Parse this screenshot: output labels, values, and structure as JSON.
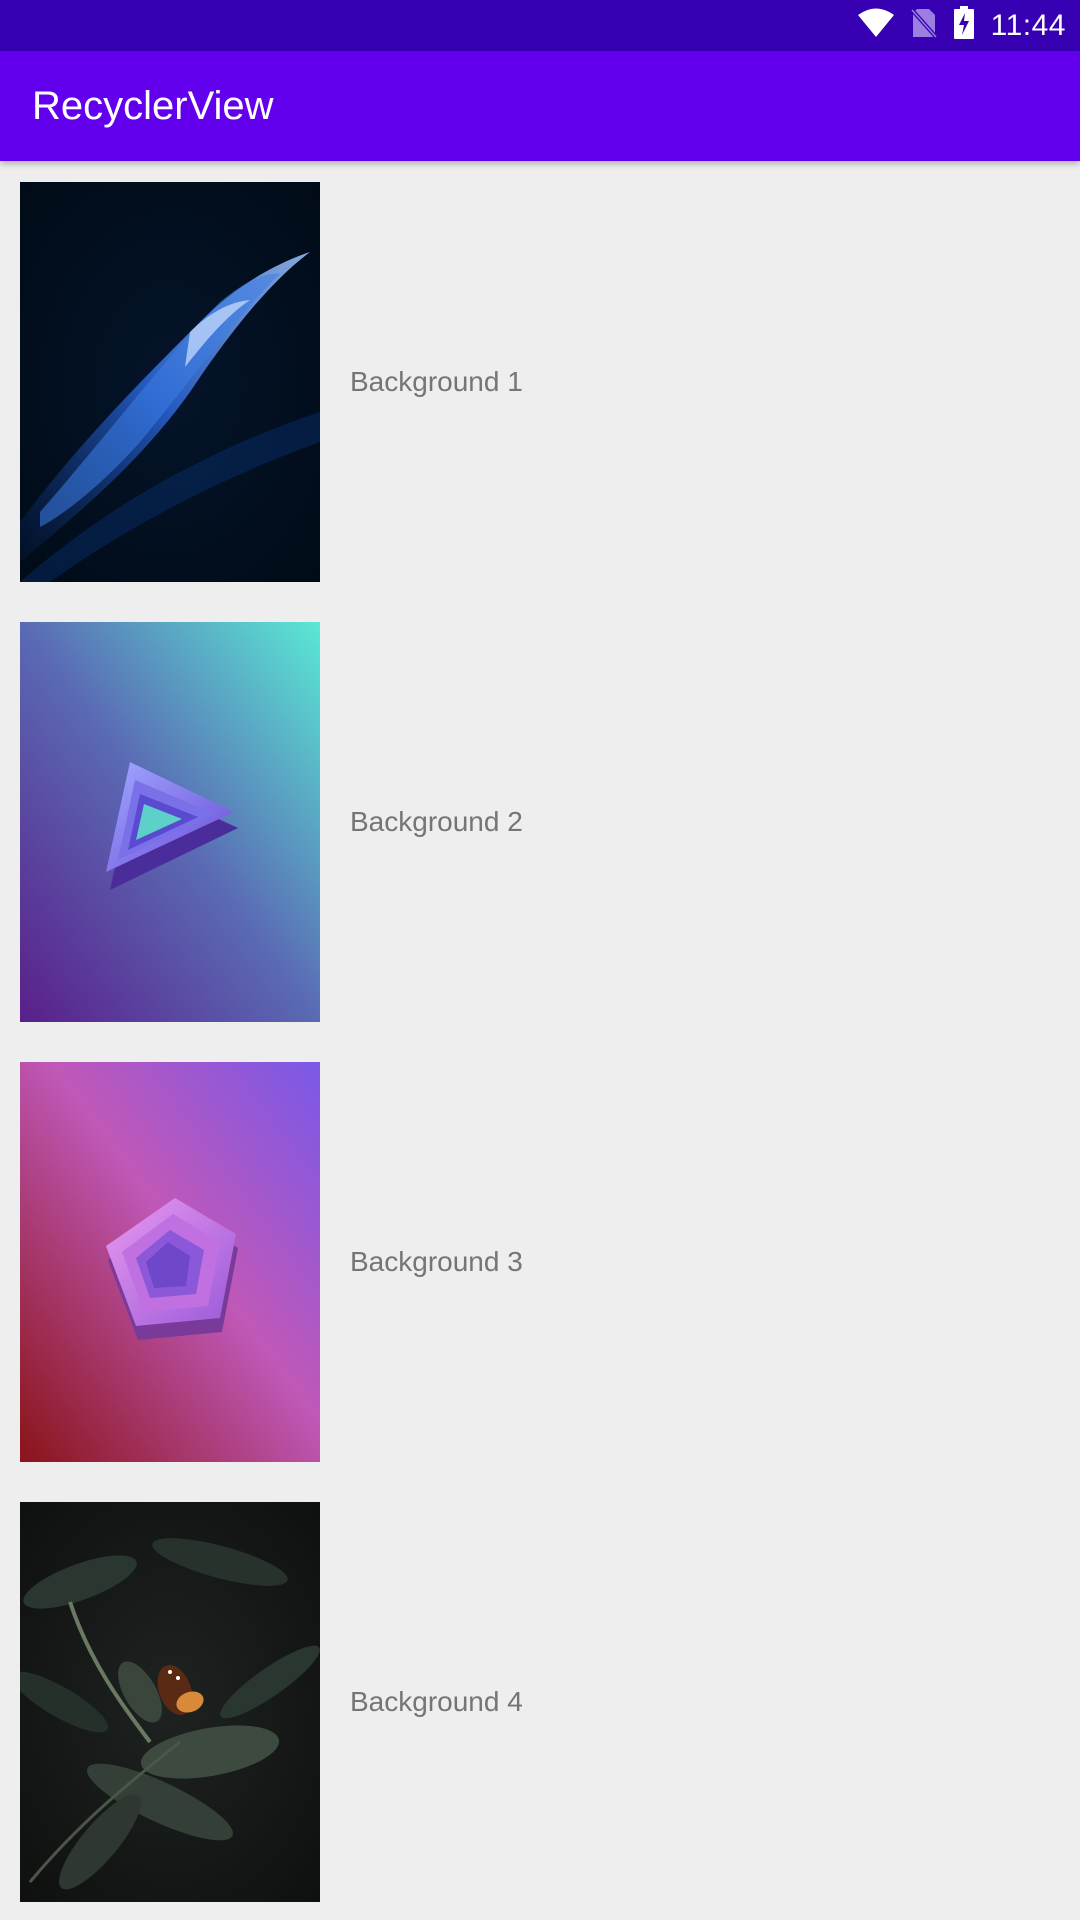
{
  "status_bar": {
    "time": "11:44",
    "icons": [
      "wifi-icon",
      "no-sim-icon",
      "battery-charging-icon"
    ],
    "color": "#3700b3"
  },
  "app_bar": {
    "title": "RecyclerView",
    "color": "#6200ee"
  },
  "list": {
    "items": [
      {
        "label": "Background 1",
        "thumbnail": "blue-wave-wallpaper"
      },
      {
        "label": "Background 2",
        "thumbnail": "teal-triangle-wallpaper"
      },
      {
        "label": "Background 3",
        "thumbnail": "pink-pentagon-wallpaper"
      },
      {
        "label": "Background 4",
        "thumbnail": "butterfly-leaves-wallpaper"
      }
    ]
  }
}
